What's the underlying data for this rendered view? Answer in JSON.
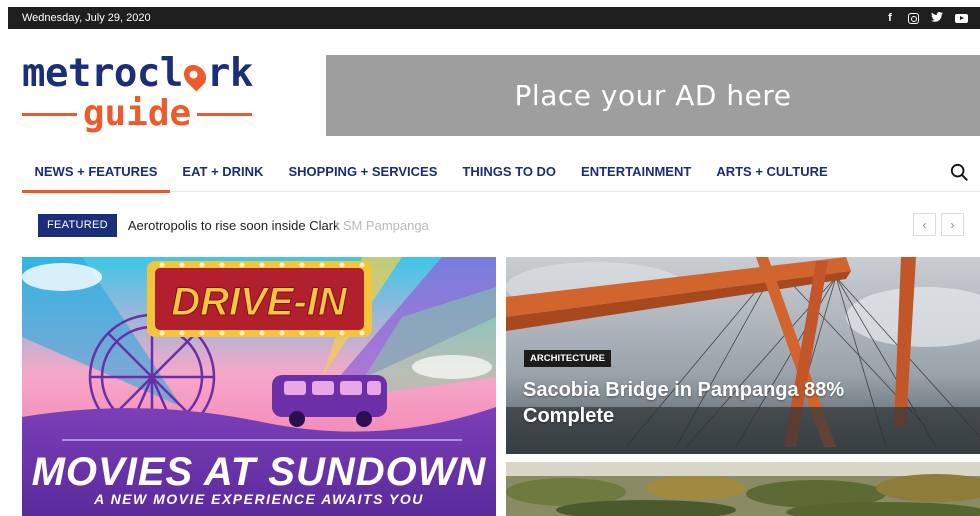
{
  "topbar": {
    "date": "Wednesday, July 29, 2020"
  },
  "social": [
    "facebook-icon",
    "instagram-icon",
    "twitter-icon",
    "youtube-icon"
  ],
  "logo": {
    "line1_a": "metrocl",
    "line1_b": "rk",
    "line2": "guide"
  },
  "ad": {
    "text": "Place your AD here"
  },
  "nav": {
    "items": [
      "NEWS + FEATURES",
      "EAT + DRINK",
      "SHOPPING + SERVICES",
      "THINGS TO DO",
      "ENTERTAINMENT",
      "ARTS + CULTURE"
    ],
    "active": 0
  },
  "ticker": {
    "badge": "FEATURED",
    "headline": "Aerotropolis to rise soon inside Clark",
    "ghost": "t SM Pampanga"
  },
  "hero": {
    "sign": "DRIVE-IN",
    "headline": "MOVIES AT SUNDOWN",
    "tagline": "A NEW MOVIE EXPERIENCE AWAITS YOU"
  },
  "tile1": {
    "category": "ARCHITECTURE",
    "title": "Sacobia Bridge in Pampanga 88% Complete"
  },
  "colors": {
    "navy": "#1a2e7a",
    "orange": "#ee5a2c",
    "topbar": "#1f1f1f",
    "ad": "#9e9e9e"
  }
}
